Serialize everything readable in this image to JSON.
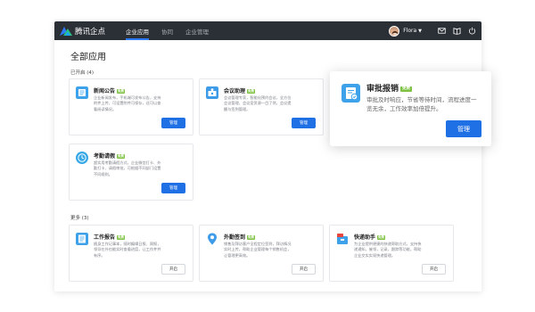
{
  "app": {
    "name": "腾讯企点"
  },
  "nav": [
    {
      "label": "企业应用",
      "active": true
    },
    {
      "label": "协同",
      "active": false
    },
    {
      "label": "企业管理",
      "active": false
    }
  ],
  "user": {
    "name": "Flora"
  },
  "toolbar_icons": [
    "mail-icon",
    "book-icon",
    "power-icon"
  ],
  "page": {
    "title": "全部应用",
    "enabled_section": "已开启 (4)",
    "more_section": "更多 (3)"
  },
  "badge": "免费",
  "enabled_apps": [
    {
      "name": "新闻公告",
      "desc": "企业新闻发布，手机端可发布公告，支持附件上传，可设置附件可保存，还可以查看阅读情况。",
      "button": "管理",
      "icon": "news-icon",
      "color": "#3ea2ea"
    },
    {
      "name": "会议助理",
      "desc": "会议管理专家，智能化预约会议，全方位会议管理，会议室资源一目了然，会议提醒与签到管理。",
      "button": "管理",
      "icon": "meeting-icon",
      "color": "#3e9be8"
    },
    {
      "name": "考勤请假",
      "desc": "超实用考勤请假方式，企业微信打卡、外勤打卡、请假审批，可根据不同部门设置不同规则。",
      "button": "管理",
      "icon": "attendance-icon",
      "color": "#38a8e6"
    }
  ],
  "more_apps": [
    {
      "name": "工作报告",
      "desc": "随身工作记事本，随时编辑日报、周报，领导在外也能实时查看进度，让工作井井有序。",
      "button": "开启",
      "icon": "report-icon",
      "color": "#3ea2ea"
    },
    {
      "name": "外勤签到",
      "desc": "销售及拜访客户全程定位签到，拜访情况实时上传，帮助企业管理每个销售机会，让管理更高效。",
      "button": "开启",
      "icon": "checkin-icon",
      "color": "#3e9be8"
    },
    {
      "name": "快递助手",
      "desc": "为企业提供便捷的快递寄取方式，支持快递通知，催领，记录，跟踪等功能，帮助企业交实实现快递管理。",
      "button": "开启",
      "icon": "express-icon",
      "color": "#3ea2ea"
    }
  ],
  "popup": {
    "name": "审批报销",
    "desc": "审批及时响应，节省等待时间，流程进度一览无余，工作效率加倍提升。",
    "button": "管理",
    "icon": "approval-icon",
    "color": "#3ea2ea"
  }
}
